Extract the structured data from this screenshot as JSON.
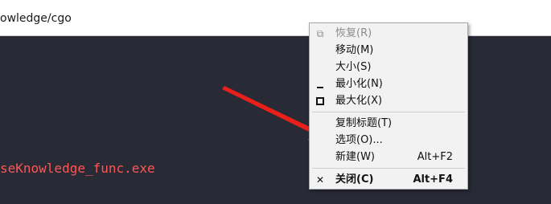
{
  "window": {
    "title": "owledge/cgo"
  },
  "terminal": {
    "line": "seKnowledge_func.exe"
  },
  "context_menu": {
    "items": [
      {
        "label": "恢复(R)",
        "accel": "",
        "icon": "restore-icon",
        "disabled": true
      },
      {
        "label": "移动(M)",
        "accel": ""
      },
      {
        "label": "大小(S)",
        "accel": ""
      },
      {
        "label": "最小化(N)",
        "accel": "",
        "icon": "minimize-icon"
      },
      {
        "label": "最大化(X)",
        "accel": "",
        "icon": "maximize-icon"
      },
      {
        "label": "复制标题(T)",
        "accel": ""
      },
      {
        "label": "选项(O)...",
        "accel": ""
      },
      {
        "label": "新建(W)",
        "accel": "Alt+F2"
      },
      {
        "label": "关闭(C)",
        "accel": "Alt+F4",
        "icon": "close-icon",
        "bold": true
      }
    ]
  },
  "colors": {
    "terminal_background": "#282a36",
    "terminal_text": "#ff5555",
    "arrow": "#e8201a",
    "menu_background": "#f2f2f2"
  }
}
